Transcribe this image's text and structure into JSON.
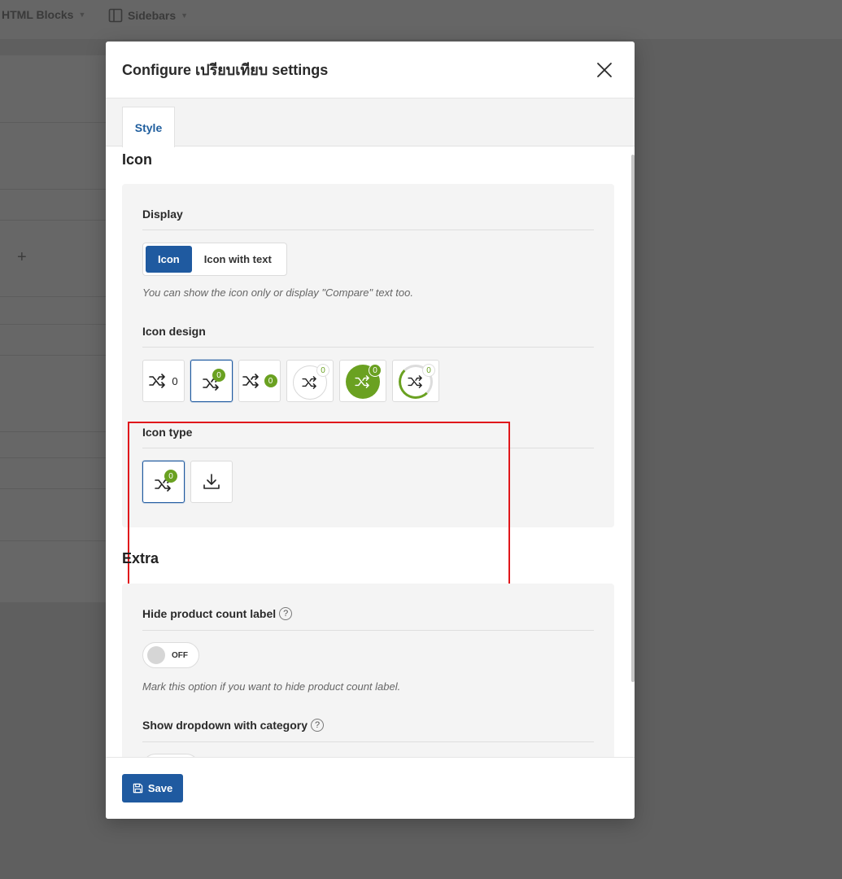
{
  "background": {
    "nav": [
      {
        "label": "HTML Blocks"
      },
      {
        "label": "Sidebars"
      }
    ]
  },
  "modal": {
    "title": "Configure เปรียบเทียบ settings",
    "tabs": [
      {
        "label": "Style"
      }
    ],
    "sections": {
      "icon": {
        "title": "Icon",
        "display": {
          "label": "Display",
          "options": [
            "Icon",
            "Icon with text"
          ],
          "selected": "Icon",
          "hint": "You can show the icon only or display \"Compare\" text too."
        },
        "icon_design": {
          "label": "Icon design",
          "options": [
            {
              "name": "count-inline",
              "count": "0"
            },
            {
              "name": "count-badge",
              "count": "0"
            },
            {
              "name": "count-side-badge",
              "count": "0"
            },
            {
              "name": "circle-outline",
              "count": "0"
            },
            {
              "name": "circle-filled",
              "count": "0"
            },
            {
              "name": "circle-border-accent",
              "count": "0"
            }
          ],
          "selected_index": 1
        },
        "icon_type": {
          "label": "Icon type",
          "options": [
            {
              "name": "shuffle-icon",
              "count": "0"
            },
            {
              "name": "download-icon"
            }
          ],
          "selected_index": 0
        }
      },
      "extra": {
        "title": "Extra",
        "hide_count": {
          "label": "Hide product count label",
          "help": "?",
          "toggle_state": "OFF",
          "hint": "Mark this option if you want to hide product count label."
        },
        "dropdown_category": {
          "label": "Show dropdown with category",
          "help": "?"
        }
      }
    },
    "footer": {
      "save_label": "Save"
    }
  },
  "colors": {
    "accent": "#1f5aa0",
    "badge_green": "#6aa121",
    "highlight": "#e0171b"
  }
}
